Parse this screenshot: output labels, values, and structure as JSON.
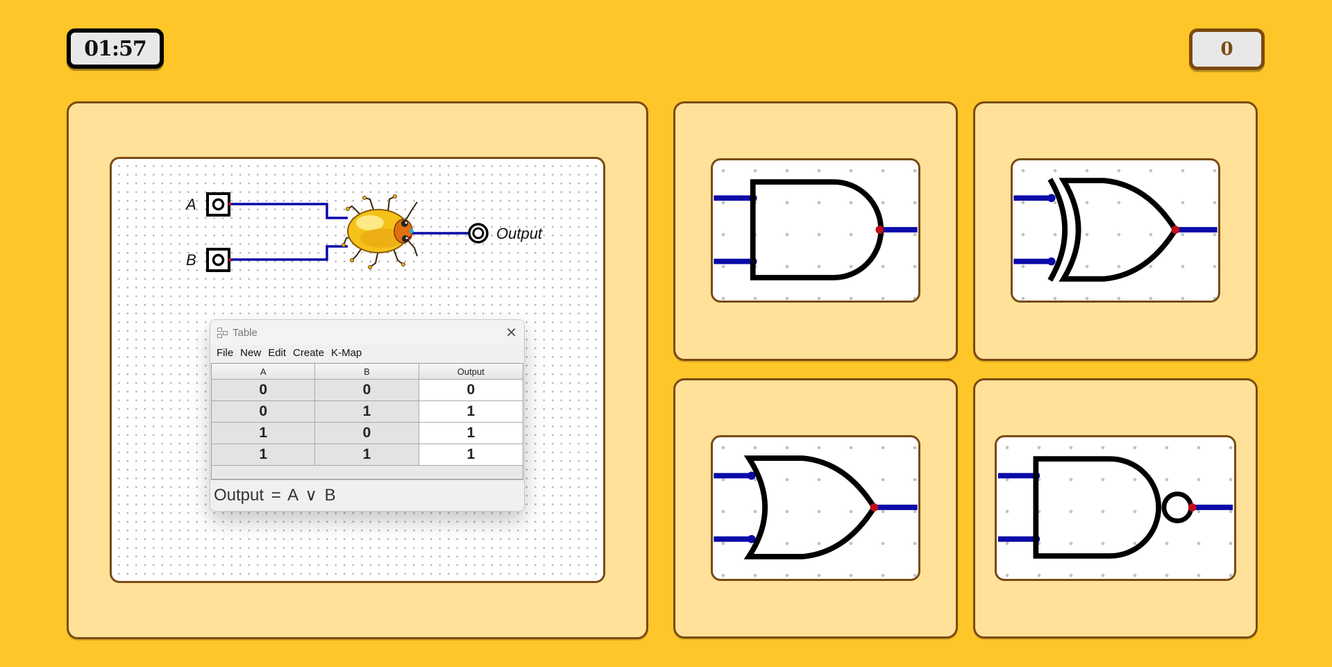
{
  "header": {
    "timer": "01:57",
    "score": "0"
  },
  "circuit": {
    "input_a_label": "A",
    "input_b_label": "B",
    "output_label": "Output",
    "bug_icon": "bug-icon"
  },
  "truth_table": {
    "title": "Table",
    "menu": [
      "File",
      "New",
      "Edit",
      "Create",
      "K-Map"
    ],
    "columns": [
      "A",
      "B",
      "Output"
    ],
    "rows": [
      [
        "0",
        "0",
        "0"
      ],
      [
        "0",
        "1",
        "1"
      ],
      [
        "1",
        "0",
        "1"
      ],
      [
        "1",
        "1",
        "1"
      ]
    ],
    "expression": "Output = A ∨ B"
  },
  "gate_options": [
    {
      "gate": "and-gate"
    },
    {
      "gate": "xor-gate"
    },
    {
      "gate": "or-gate"
    },
    {
      "gate": "nand-gate"
    }
  ],
  "colors": {
    "background": "#ffc629",
    "panel": "#ffe199",
    "border": "#7a4a14",
    "wire": "#0a0aa8",
    "pin": "#c0101a"
  }
}
